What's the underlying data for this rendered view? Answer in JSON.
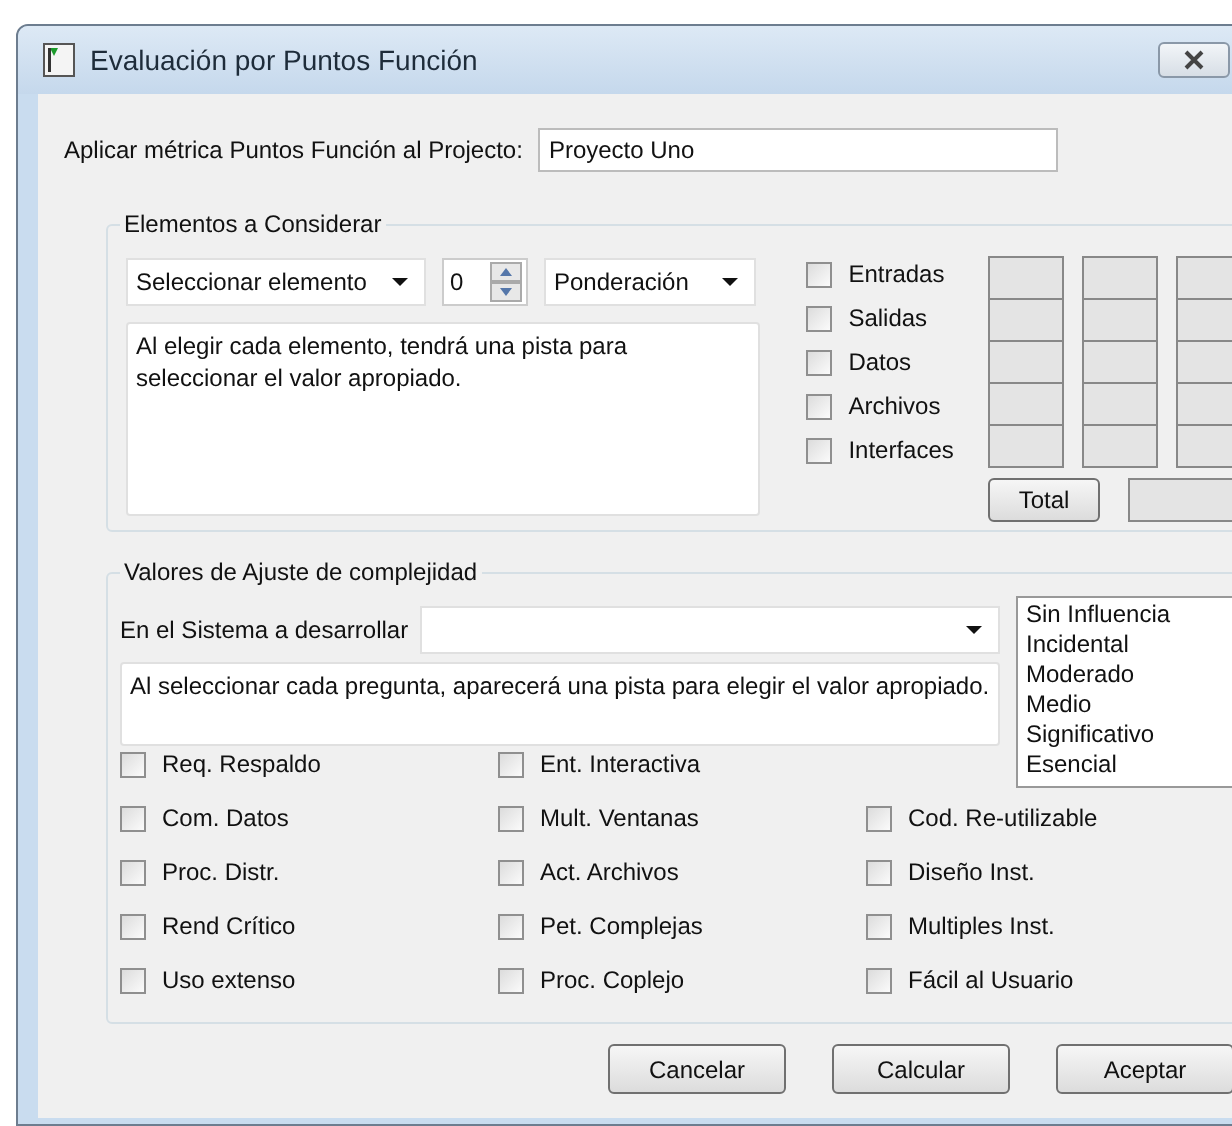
{
  "window": {
    "title": "Evaluación por Puntos Función"
  },
  "project": {
    "label": "Aplicar métrica Puntos Función al  Projecto:",
    "value": "Proyecto Uno"
  },
  "elements_group": {
    "title": "Elementos a Considerar",
    "element_select": "Seleccionar elemento",
    "spinner_value": "0",
    "weight_select": "Ponderación",
    "hint": "Al elegir cada elemento, tendrá  una pista para seleccionar el valor apropiado.",
    "elements": [
      {
        "label": "Entradas",
        "checked": false
      },
      {
        "label": "Salidas",
        "checked": false
      },
      {
        "label": "Datos",
        "checked": false
      },
      {
        "label": "Archivos",
        "checked": false
      },
      {
        "label": "Interfaces",
        "checked": false
      }
    ],
    "total_button": "Total"
  },
  "adjust_group": {
    "title": "Valores de Ajuste  de complejidad",
    "question_label": "En el Sistema a desarrollar",
    "hint": "Al seleccionar cada pregunta, aparecerá  una pista para elegir el valor apropiado.",
    "levels": [
      "Sin Influencia",
      "Incidental",
      "Moderado",
      "Medio",
      "Significativo",
      "Esencial"
    ],
    "factor_columns": [
      [
        {
          "label": "Req. Respaldo",
          "checked": false
        },
        {
          "label": "Com. Datos",
          "checked": false
        },
        {
          "label": "Proc. Distr.",
          "checked": false
        },
        {
          "label": "Rend Crítico",
          "checked": false
        },
        {
          "label": "Uso extenso",
          "checked": false
        }
      ],
      [
        {
          "label": "Ent. Interactiva",
          "checked": false
        },
        {
          "label": "Mult.  Ventanas",
          "checked": false
        },
        {
          "label": "Act. Archivos",
          "checked": false
        },
        {
          "label": "Pet. Complejas",
          "checked": false
        },
        {
          "label": "Proc. Coplejo",
          "checked": false
        }
      ],
      [
        {
          "label": "Cod. Re-utilizable",
          "checked": false
        },
        {
          "label": "Diseño Inst.",
          "checked": false
        },
        {
          "label": "Multiples Inst.",
          "checked": false
        },
        {
          "label": "Fácil al Usuario",
          "checked": false
        }
      ]
    ]
  },
  "buttons": [
    "Cancelar",
    "Calcular",
    "Aceptar"
  ]
}
